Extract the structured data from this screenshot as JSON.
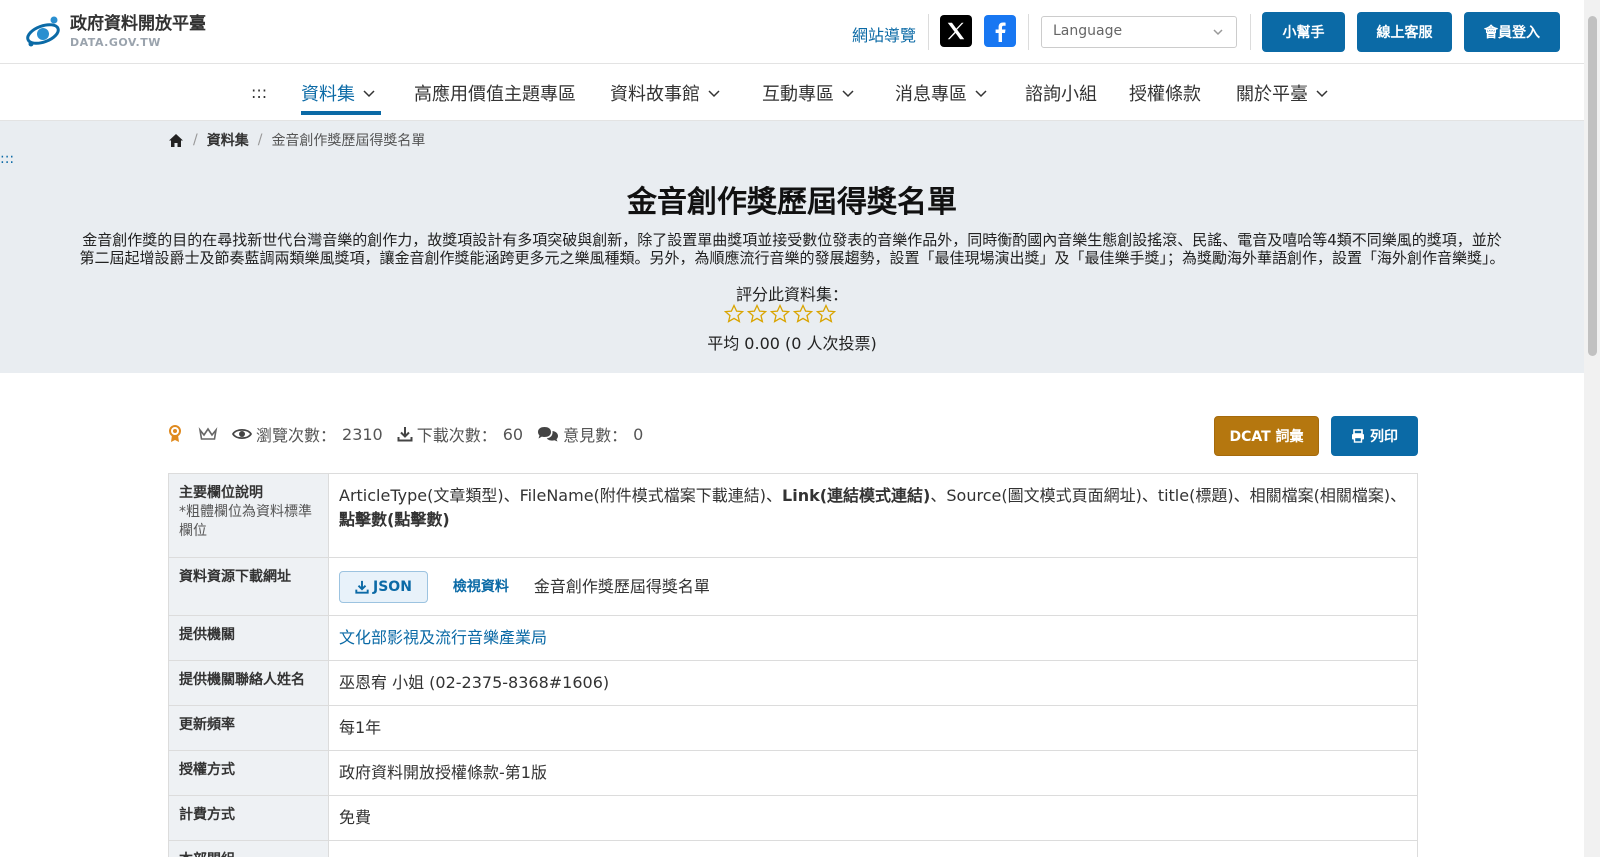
{
  "header": {
    "logo_title": "政府資料開放平臺",
    "logo_sub": "DATA.GOV.TW",
    "sitemap": "網站導覽",
    "language_placeholder": "Language",
    "buttons": [
      "小幫手",
      "線上客服",
      "會員登入"
    ]
  },
  "nav": {
    "skip": ":::",
    "items": [
      {
        "label": "資料集",
        "dropdown": true,
        "active": true
      },
      {
        "label": "高應用價值主題專區",
        "dropdown": false
      },
      {
        "label": "資料故事館",
        "dropdown": true
      },
      {
        "label": "互動專區",
        "dropdown": true
      },
      {
        "label": "消息專區",
        "dropdown": true
      },
      {
        "label": "諮詢小組",
        "dropdown": false
      },
      {
        "label": "授權條款",
        "dropdown": false
      },
      {
        "label": "關於平臺",
        "dropdown": true
      }
    ]
  },
  "breadcrumb": {
    "items": [
      "資料集",
      "金音創作獎歷屆得獎名單"
    ]
  },
  "skip_side": ":::",
  "hero": {
    "title": "金音創作獎歷屆得獎名單",
    "desc_line1": "金音創作獎的目的在尋找新世代台灣音樂的創作力，故獎項設計有多項突破與創新，除了設置單曲獎項並接受數位發表的音樂作品外，同時衡酌國內音樂生態創設搖滾、民謠、電音及嘻哈等4類不同樂風的獎項，並於",
    "desc_line2": "第二屆起增設爵士及節奏藍調兩類樂風獎項，讓金音創作獎能涵跨更多元之樂風種類。另外，為順應流行音樂的發展趨勢，設置「最佳現場演出獎」及「最佳樂手獎」；為獎勵海外華語創作，設置「海外創作音樂獎」。",
    "rate_label": "評分此資料集：",
    "rating": 0,
    "avg": "平均 0.00 (0 人次投票)"
  },
  "stats": {
    "views_label": "瀏覽次數：",
    "views": "2310",
    "downloads_label": "下載次數：",
    "downloads": "60",
    "comments_label": "意見數：",
    "comments": "0"
  },
  "actions": {
    "dcat": "DCAT 詞彙",
    "print": "列印"
  },
  "table": {
    "fields_label": "主要欄位說明",
    "fields_note": "*粗體欄位為資料標準欄位",
    "fields_parts": [
      {
        "text": "ArticleType(文章類型)、FileName(附件模式檔案下載連結)、",
        "bold": false
      },
      {
        "text": "Link(連結模式連結)",
        "bold": true
      },
      {
        "text": "、Source(圖文模式頁面網址)、title(標題)、相關檔案(相關檔案)、",
        "bold": false
      },
      {
        "text": "點擊數(點擊數)",
        "bold": true
      }
    ],
    "download_label": "資料資源下載網址",
    "json_label": "JSON",
    "view_data": "檢視資料",
    "resource_name": "金音創作獎歷屆得獎名單",
    "provider_label": "提供機關",
    "provider": "文化部影視及流行音樂產業局",
    "contact_label": "提供機關聯絡人姓名",
    "contact": "巫恩宥 小姐 (02-2375-8368#1606)",
    "freq_label": "更新頻率",
    "freq": "每1年",
    "license_label": "授權方式",
    "license": "政府資料開放授權條款-第1版",
    "fee_label": "計費方式",
    "fee": "免費",
    "next_label": "本部門組"
  },
  "colors": {
    "primary": "#0b6aa6",
    "dcat": "#b5770f",
    "hero_bg": "#e9edf1",
    "star": "#d9a400"
  }
}
